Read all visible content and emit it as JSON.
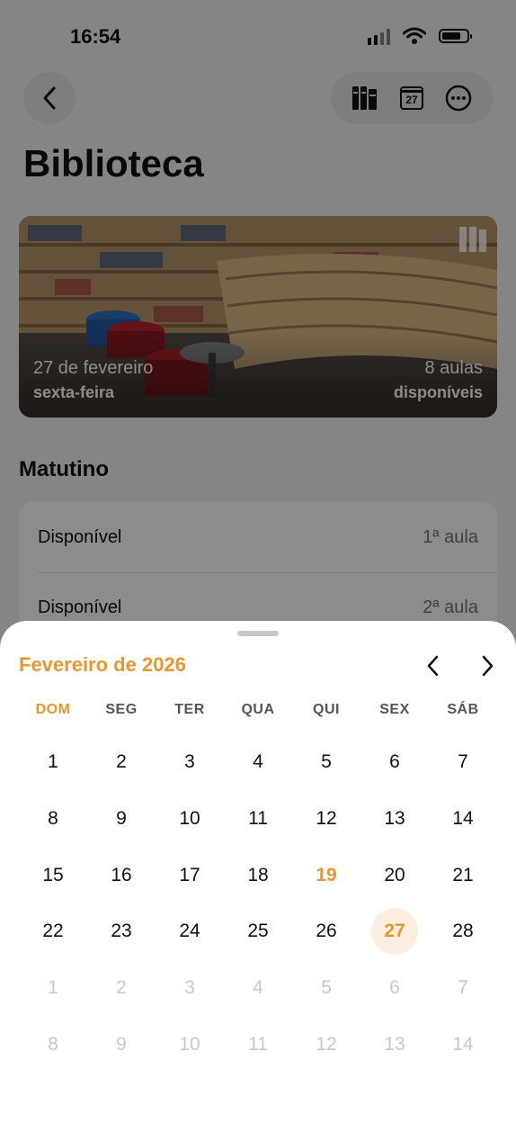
{
  "status": {
    "time": "16:54"
  },
  "header": {
    "title": "Biblioteca"
  },
  "hero": {
    "date": "27 de fevereiro",
    "weekday": "sexta-feira",
    "lessons_count": "8 aulas",
    "availability": "disponíveis"
  },
  "section": {
    "title": "Matutino"
  },
  "slots": [
    {
      "status": "Disponível",
      "lesson": "1ª aula"
    },
    {
      "status": "Disponível",
      "lesson": "2ª aula"
    }
  ],
  "calendar": {
    "month_title": "Fevereiro de 2026",
    "weekdays": [
      "DOM",
      "SEG",
      "TER",
      "QUA",
      "QUI",
      "SEX",
      "SÁB"
    ],
    "today": 19,
    "selected": 27,
    "accent_color": "#e8962f",
    "days": [
      {
        "n": "1",
        "m": false
      },
      {
        "n": "2",
        "m": false
      },
      {
        "n": "3",
        "m": false
      },
      {
        "n": "4",
        "m": false
      },
      {
        "n": "5",
        "m": false
      },
      {
        "n": "6",
        "m": false
      },
      {
        "n": "7",
        "m": false
      },
      {
        "n": "8",
        "m": false
      },
      {
        "n": "9",
        "m": false
      },
      {
        "n": "10",
        "m": false
      },
      {
        "n": "11",
        "m": false
      },
      {
        "n": "12",
        "m": false
      },
      {
        "n": "13",
        "m": false
      },
      {
        "n": "14",
        "m": false
      },
      {
        "n": "15",
        "m": false
      },
      {
        "n": "16",
        "m": false
      },
      {
        "n": "17",
        "m": false
      },
      {
        "n": "18",
        "m": false
      },
      {
        "n": "19",
        "m": false
      },
      {
        "n": "20",
        "m": false
      },
      {
        "n": "21",
        "m": false
      },
      {
        "n": "22",
        "m": false
      },
      {
        "n": "23",
        "m": false
      },
      {
        "n": "24",
        "m": false
      },
      {
        "n": "25",
        "m": false
      },
      {
        "n": "26",
        "m": false
      },
      {
        "n": "27",
        "m": false
      },
      {
        "n": "28",
        "m": false
      },
      {
        "n": "1",
        "m": true
      },
      {
        "n": "2",
        "m": true
      },
      {
        "n": "3",
        "m": true
      },
      {
        "n": "4",
        "m": true
      },
      {
        "n": "5",
        "m": true
      },
      {
        "n": "6",
        "m": true
      },
      {
        "n": "7",
        "m": true
      },
      {
        "n": "8",
        "m": true
      },
      {
        "n": "9",
        "m": true
      },
      {
        "n": "10",
        "m": true
      },
      {
        "n": "11",
        "m": true
      },
      {
        "n": "12",
        "m": true
      },
      {
        "n": "13",
        "m": true
      },
      {
        "n": "14",
        "m": true
      }
    ]
  },
  "icons": {
    "back": "chevron-left-icon",
    "library": "books-icon",
    "calendar": "calendar-icon",
    "more": "ellipsis-circle-icon",
    "prev": "chevron-left-icon",
    "next": "chevron-right-icon"
  }
}
